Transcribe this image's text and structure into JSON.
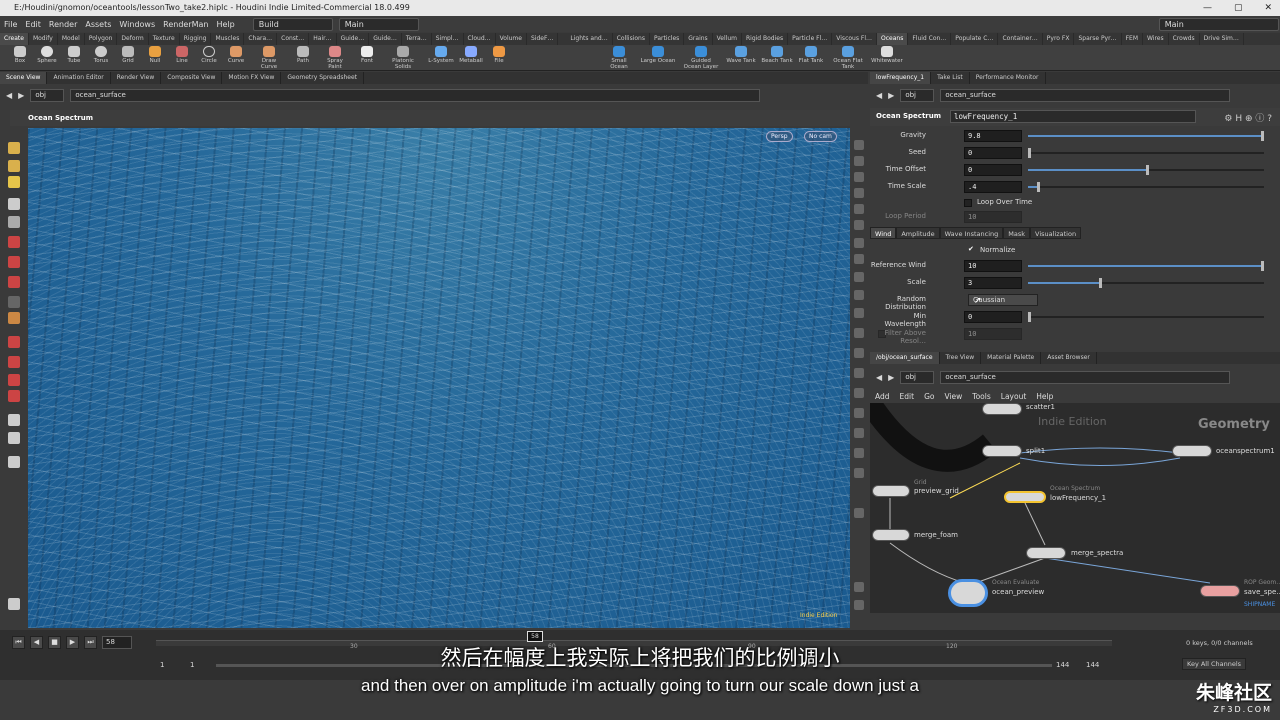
{
  "window": {
    "title": "E:/Houdini/gnomon/oceantools/lessonTwo_take2.hiplc - Houdini Indie Limited-Commercial 18.0.499"
  },
  "menu": [
    "File",
    "Edit",
    "Render",
    "Assets",
    "Windows",
    "RenderMan",
    "Help"
  ],
  "desktops": {
    "left": "Build",
    "center": "Main",
    "right": "Main"
  },
  "shelf_tabs_left": [
    "Create",
    "Modify",
    "Model",
    "Polygon",
    "Deform",
    "Texture",
    "Rigging",
    "Muscles",
    "Chara…",
    "Const…",
    "Hair…",
    "Guide…",
    "Guide…",
    "Terra…",
    "Simpl…",
    "Cloud…",
    "Volume",
    "SideF…"
  ],
  "shelf_tabs_right": [
    "Lights and…",
    "Collisions",
    "Particles",
    "Grains",
    "Vellum",
    "Rigid Bodies",
    "Particle Fl…",
    "Viscous Fl…",
    "Oceans",
    "Fluid Con…",
    "Populate C…",
    "Container…",
    "Pyro FX",
    "Sparse Pyr…",
    "FEM",
    "Wires",
    "Crowds",
    "Drive Sim…"
  ],
  "shelf_tools_left": [
    "Box",
    "Sphere",
    "Tube",
    "Torus",
    "Grid",
    "Null",
    "Line",
    "Circle",
    "Curve",
    "Draw Curve",
    "Path",
    "Spray Paint",
    "Font",
    "Platonic Solids",
    "L-System",
    "Metaball",
    "File"
  ],
  "shelf_tools_right": [
    "Small Ocean",
    "Large Ocean",
    "Guided Ocean Layer",
    "Wave Tank",
    "Beach Tank",
    "Flat Tank",
    "Ocean Flat Tank",
    "Whitewater"
  ],
  "pane_tabs_left": [
    "Scene View",
    "Animation Editor",
    "Render View",
    "Composite View",
    "Motion FX View",
    "Geometry Spreadsheet"
  ],
  "pane_tabs_right": [
    "lowFrequency_1",
    "Take List",
    "Performance Monitor"
  ],
  "path": {
    "obj": "obj",
    "node": "ocean_surface"
  },
  "viewport": {
    "title": "Ocean Spectrum",
    "persp": "Persp",
    "cam": "No cam",
    "edition": "Indie Edition"
  },
  "params": {
    "node_type": "Ocean Spectrum",
    "node_name": "lowFrequency_1",
    "rows": [
      {
        "label": "Gravity",
        "value": "9.8",
        "frac": 0.99
      },
      {
        "label": "Seed",
        "value": "0",
        "frac": 0
      },
      {
        "label": "Time Offset",
        "value": "0",
        "frac": 0.5
      },
      {
        "label": "Time Scale",
        "value": ".4",
        "frac": 0.04
      }
    ],
    "loop_over_time": "Loop Over Time",
    "loop_period": {
      "label": "Loop Period",
      "value": "10"
    },
    "subtabs": [
      "Wind",
      "Amplitude",
      "Wave Instancing",
      "Mask",
      "Visualization"
    ],
    "normalize": "Normalize",
    "wind_rows": [
      {
        "label": "Reference Wind",
        "value": "10",
        "frac": 0.99
      },
      {
        "label": "Scale",
        "value": "3",
        "frac": 0.3
      },
      {
        "label": "Min Wavelength",
        "value": "0",
        "frac": 0
      }
    ],
    "random_distribution": {
      "label": "Random Distribution",
      "value": "Gaussian"
    },
    "filter": {
      "label": "Filter Above Resol…",
      "value": "10"
    }
  },
  "net_tabs": [
    "/obj/ocean_surface",
    "Tree View",
    "Material Palette",
    "Asset Browser"
  ],
  "net_menu": [
    "Add",
    "Edit",
    "Go",
    "View",
    "Tools",
    "Layout",
    "Help"
  ],
  "network": {
    "context": "Geometry",
    "edition": "Indie Edition",
    "nodes": [
      {
        "name": "scatter1",
        "type": ""
      },
      {
        "name": "split1",
        "type": ""
      },
      {
        "name": "oceanspectrum1",
        "type": ""
      },
      {
        "name": "preview_grid",
        "type": "Grid"
      },
      {
        "name": "lowFrequency_1",
        "type": "Ocean Spectrum"
      },
      {
        "name": "merge_foam",
        "type": ""
      },
      {
        "name": "merge_spectra",
        "type": ""
      },
      {
        "name": "ocean_preview",
        "type": "Ocean Evaluate"
      },
      {
        "name": "save_spe…",
        "type": "ROP Geom…",
        "extra": "SHIPNAME"
      }
    ]
  },
  "timeline": {
    "frame": "58",
    "current": "58",
    "ticks": [
      "30",
      "60",
      "90",
      "120"
    ],
    "start": "1",
    "start2": "1",
    "end": "144",
    "end2": "144",
    "keys": "0 keys, 0/0 channels",
    "key_all": "Key All Channels"
  },
  "subtitles": {
    "zh": "然后在幅度上我实际上将把我们的比例调小",
    "en": "and then over on amplitude i'm actually going to turn our scale down just a"
  },
  "watermark": {
    "brand": "朱峰社区",
    "url": "ZF3D.COM"
  },
  "colors": {
    "ocean": "#1f6298",
    "accent": "#f4c430",
    "slider": "#5b8fc7"
  }
}
